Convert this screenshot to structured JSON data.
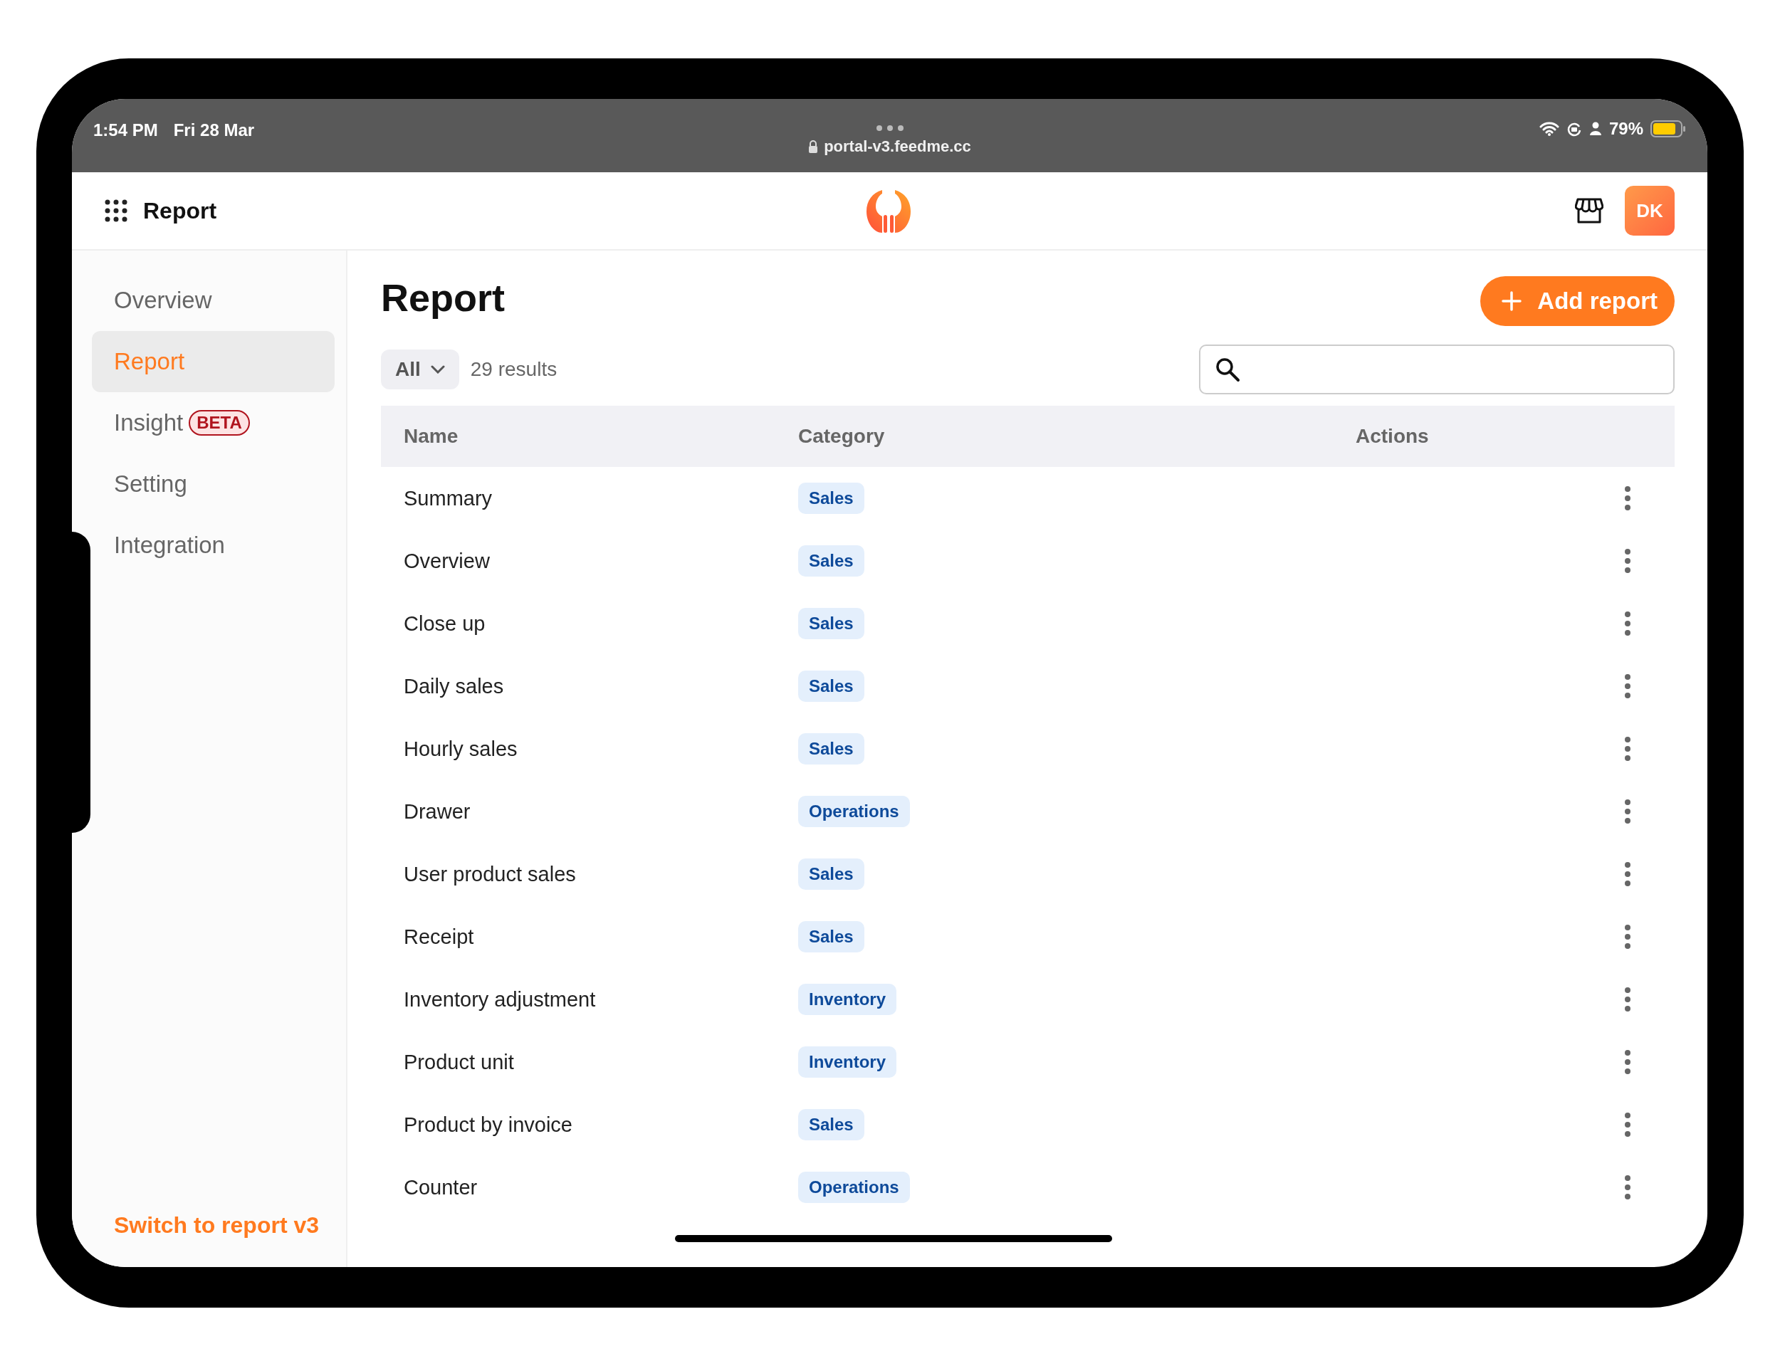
{
  "status_bar": {
    "time": "1:54 PM",
    "date": "Fri 28 Mar",
    "url": "portal-v3.feedme.cc",
    "battery": "79%"
  },
  "app_bar": {
    "title": "Report",
    "avatar": "DK"
  },
  "sidebar": {
    "items": [
      {
        "label": "Overview",
        "selected": false
      },
      {
        "label": "Report",
        "selected": true
      },
      {
        "label": "Insight",
        "selected": false,
        "badge": "BETA"
      },
      {
        "label": "Setting",
        "selected": false
      },
      {
        "label": "Integration",
        "selected": false
      }
    ],
    "footer_link": "Switch to report v3"
  },
  "page": {
    "title": "Report",
    "add_button": "Add report",
    "filter": "All",
    "results": "29 results"
  },
  "table": {
    "columns": [
      "Name",
      "Category",
      "Actions"
    ],
    "rows": [
      {
        "name": "Summary",
        "category": "Sales"
      },
      {
        "name": "Overview",
        "category": "Sales"
      },
      {
        "name": "Close up",
        "category": "Sales"
      },
      {
        "name": "Daily sales",
        "category": "Sales"
      },
      {
        "name": "Hourly sales",
        "category": "Sales"
      },
      {
        "name": "Drawer",
        "category": "Operations"
      },
      {
        "name": "User product sales",
        "category": "Sales"
      },
      {
        "name": "Receipt",
        "category": "Sales"
      },
      {
        "name": "Inventory adjustment",
        "category": "Inventory"
      },
      {
        "name": "Product unit",
        "category": "Inventory"
      },
      {
        "name": "Product by invoice",
        "category": "Sales"
      },
      {
        "name": "Counter",
        "category": "Operations"
      }
    ]
  }
}
